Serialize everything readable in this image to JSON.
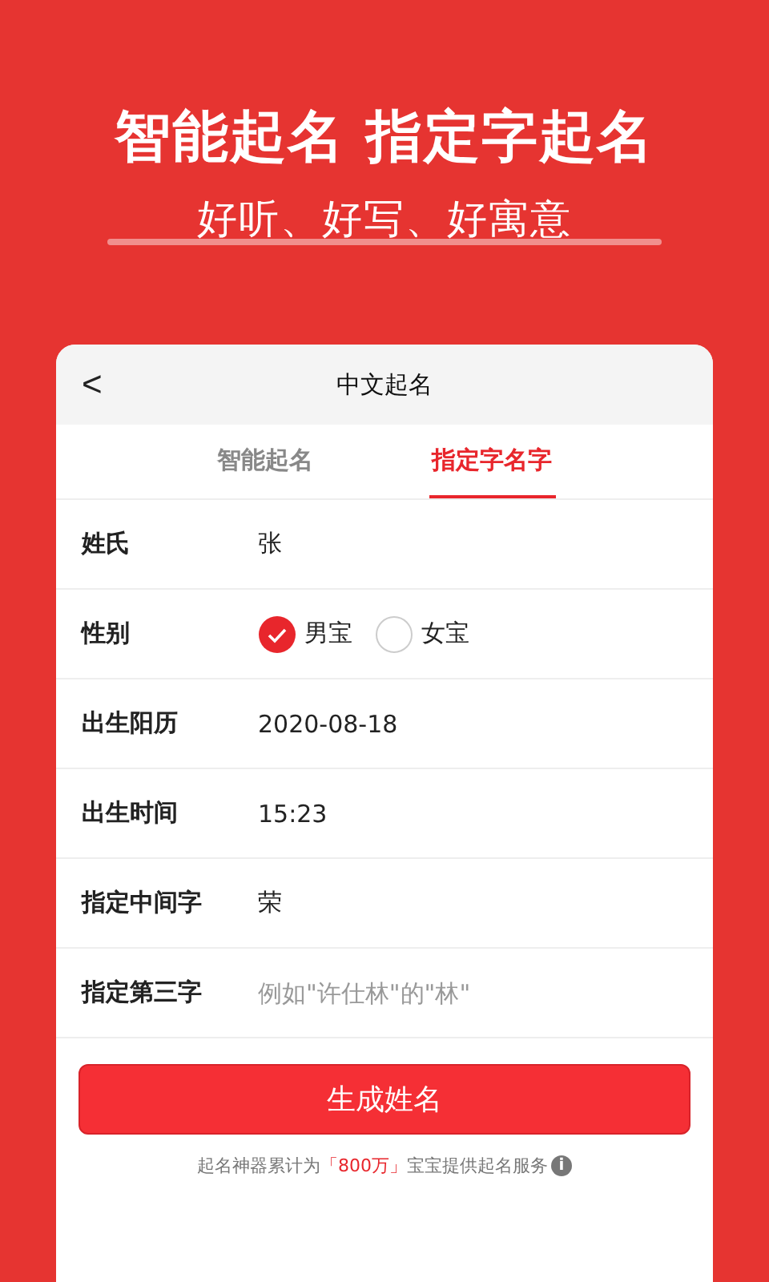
{
  "banner": {
    "title": "智能起名 指定字起名",
    "subtitle": "好听、好写、好寓意"
  },
  "card": {
    "back": "<",
    "title": "中文起名"
  },
  "tabs": [
    {
      "label": "智能起名",
      "selected": false
    },
    {
      "label": "指定字名字",
      "selected": true
    }
  ],
  "fields": [
    {
      "kind": "text",
      "label": "姓氏",
      "value": "张"
    },
    {
      "kind": "radio",
      "label": "性别",
      "options": [
        {
          "label": "男宝",
          "selected": true
        },
        {
          "label": "女宝",
          "selected": false
        }
      ]
    },
    {
      "kind": "text",
      "label": "出生阳历",
      "value": "2020-08-18"
    },
    {
      "kind": "text",
      "label": "出生时间",
      "value": "15:23"
    },
    {
      "kind": "text",
      "label": "指定中间字",
      "value": "荣"
    },
    {
      "kind": "input",
      "label": "指定第三字",
      "placeholder": "例如\"许仕林\"的\"林\""
    }
  ],
  "submit": "生成姓名",
  "footer": {
    "before": "起名神器累计为",
    "highlight": "「800万」",
    "after": "宝宝提供起名服务",
    "info": "i"
  }
}
